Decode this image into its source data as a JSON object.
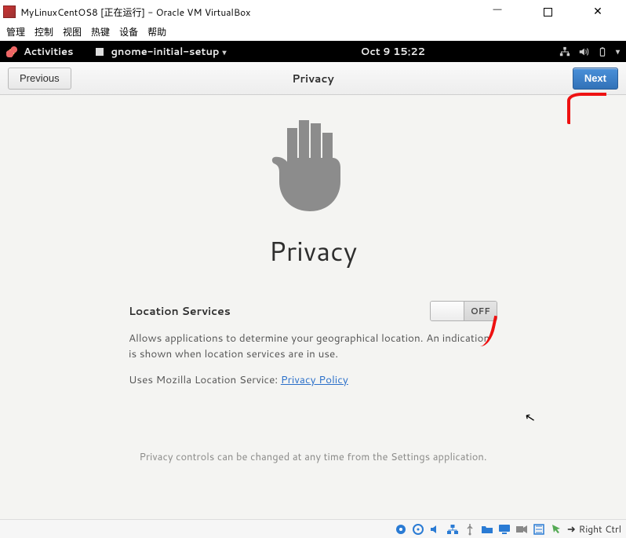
{
  "vb": {
    "title": "MyLinuxCentOS8 [正在运行] - Oracle VM VirtualBox",
    "menu": [
      "管理",
      "控制",
      "视图",
      "热键",
      "设备",
      "帮助"
    ],
    "host_key": "Right Ctrl"
  },
  "gnome": {
    "activities": "Activities",
    "appname": "gnome-initial-setup",
    "clock": "Oct 9  15:22"
  },
  "setup": {
    "previous": "Previous",
    "next": "Next",
    "title_small": "Privacy",
    "heading": "Privacy",
    "location_label": "Location Services",
    "toggle_state": "OFF",
    "description": "Allows applications to determine your geographical location. An indication is shown when location services are in use.",
    "uses_prefix": "Uses Mozilla Location Service: ",
    "policy_link": "Privacy Policy",
    "footer": "Privacy controls can be changed at any time from the Settings application."
  }
}
